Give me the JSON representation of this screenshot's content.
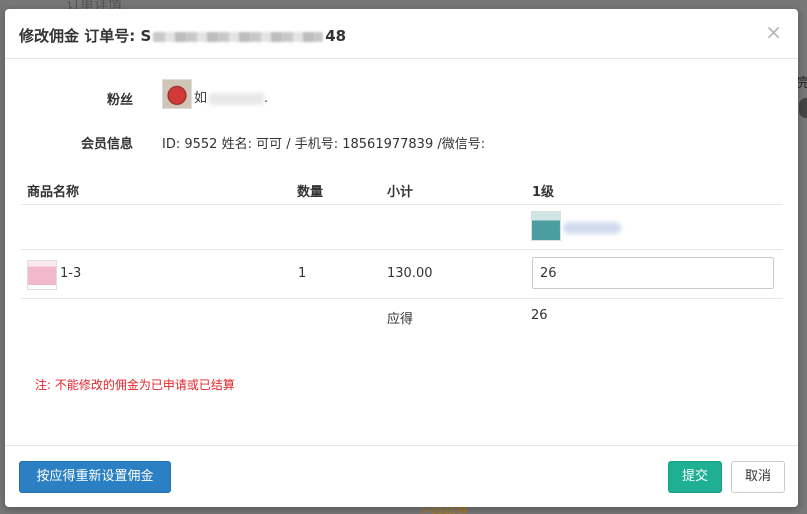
{
  "modal": {
    "title_prefix": "修改佣金 订单号: S",
    "title_suffix": "48",
    "close_symbol": "×"
  },
  "fan": {
    "label": "粉丝",
    "name_visible": "如",
    "name_tail": "."
  },
  "member": {
    "label": "会员信息",
    "info": "ID: 9552 姓名: 可可 / 手机号: 18561977839 /微信号:"
  },
  "table": {
    "headers": [
      "商品名称",
      "数量",
      "小计",
      "1级"
    ],
    "rows": [
      {
        "product": "1-3",
        "quantity": "1",
        "subtotal": "130.00",
        "commission_value": "26"
      }
    ],
    "summary_label": "应得",
    "summary_value": "26"
  },
  "note": "注: 不能修改的佣金为已申请或已结算",
  "buttons": {
    "reset": "按应得重新设置佣金",
    "submit": "提交",
    "cancel": "取消"
  },
  "colors": {
    "primary": "#2b80c3",
    "success": "#1fb094",
    "danger": "#e4252b"
  }
}
